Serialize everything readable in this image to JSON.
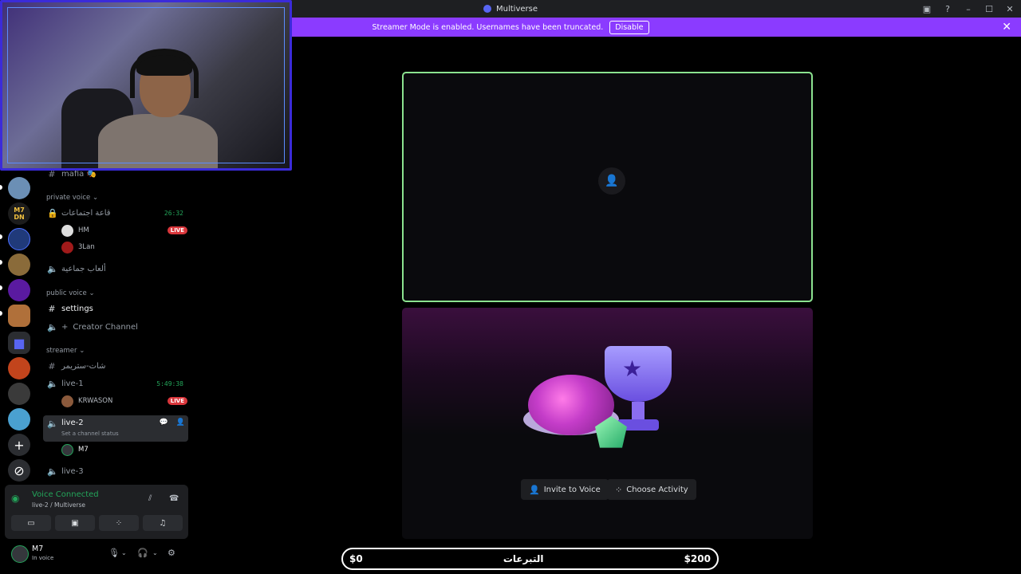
{
  "window": {
    "title": "Multiverse",
    "icon": "compass-icon"
  },
  "banner": {
    "text": "Streamer Mode is enabled. Usernames have been truncated.",
    "disable_label": "Disable",
    "close_glyph": "✕",
    "color": "#8b3bff"
  },
  "sidebar": {
    "top_channel": "mafia 🎭",
    "categories": {
      "private_voice": "private voice ⌄",
      "public_voice": "public voice ⌄",
      "streamer": "streamer ⌄"
    },
    "channels": {
      "meeting_room": "قاعة اجتماعات",
      "meeting_room_timer": "26:32",
      "games_room": "ألعاب جماعية",
      "settings": "settings",
      "creator": "Creator Channel",
      "streamer_chat": "شات-ستريمر",
      "live1": "live-1",
      "live1_timer": "5:49:38",
      "live2": "live-2",
      "live2_status": "Set a channel status",
      "live3": "live-3"
    },
    "users": {
      "hm": "HM",
      "lan": "3Lan",
      "krwason": "KRWASON",
      "m7": "M7"
    },
    "live_badge": "LIVE"
  },
  "rail": {
    "server_badge": "M7\nDN"
  },
  "voice_panel": {
    "title": "Voice Connected",
    "subtitle": "live-2 / Multiverse"
  },
  "user": {
    "name": "M7",
    "status": "In voice"
  },
  "stage": {
    "invite_label": "Invite to Voice",
    "activity_label": "Choose Activity"
  },
  "donations": {
    "left": "$0",
    "center": "التبرعات",
    "right": "$200"
  },
  "colors": {
    "accent_green": "#23a55a",
    "live_red": "#da373c",
    "tile_border": "#8be28f"
  }
}
